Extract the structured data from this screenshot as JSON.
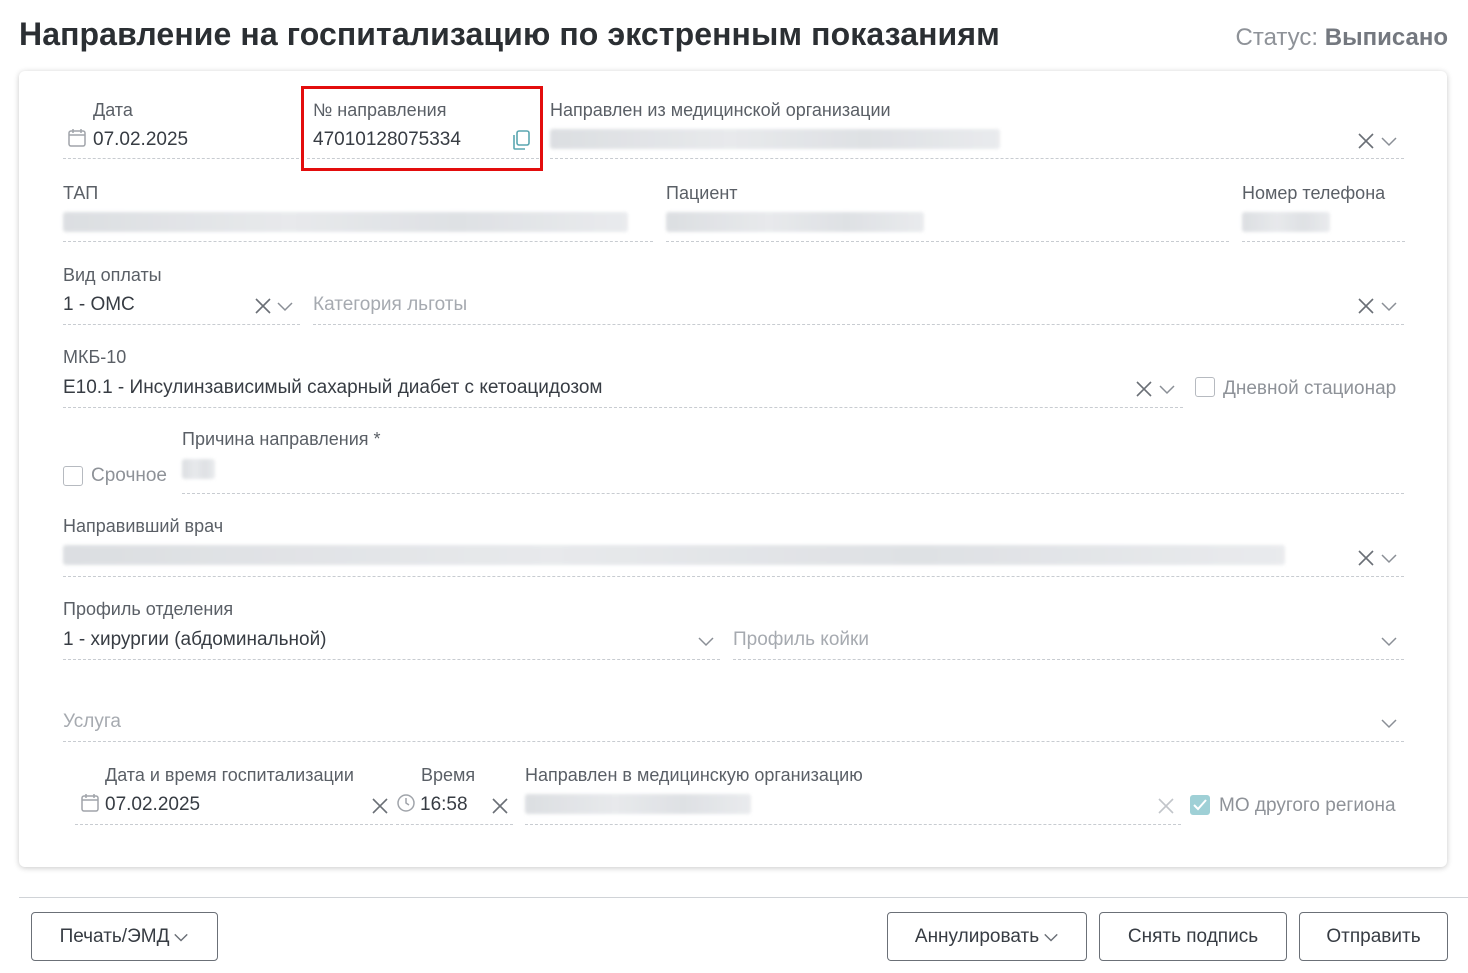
{
  "header": {
    "title": "Направление на госпитализацию по экстренным показаниям",
    "status_label": "Статус:",
    "status_value": "Выписано"
  },
  "form": {
    "date": {
      "label": "Дата",
      "value": "07.02.2025"
    },
    "referral_number": {
      "label": "№ направления",
      "value": "47010128075334"
    },
    "from_org": {
      "label": "Направлен из медицинской организации"
    },
    "tap": {
      "label": "ТАП"
    },
    "patient": {
      "label": "Пациент"
    },
    "phone": {
      "label": "Номер телефона"
    },
    "payment": {
      "label": "Вид оплаты",
      "value": "1 - ОМС"
    },
    "benefit": {
      "placeholder": "Категория льготы"
    },
    "mkb": {
      "label": "МКБ-10",
      "value": "E10.1 - Инсулинзависимый сахарный диабет с кетоацидозом"
    },
    "day_hospital": {
      "label": "Дневной стационар",
      "checked": false
    },
    "urgent": {
      "label": "Срочное",
      "checked": false
    },
    "reason": {
      "label": "Причина направления *"
    },
    "doctor": {
      "label": "Направивший врач"
    },
    "dept_profile": {
      "label": "Профиль отделения",
      "value": "1 - хирургии (абдоминальной)"
    },
    "bed_profile": {
      "placeholder": "Профиль койки"
    },
    "service": {
      "placeholder": "Услуга"
    },
    "hosp_datetime": {
      "label": "Дата и время госпитализации",
      "value": "07.02.2025"
    },
    "time": {
      "label": "Время",
      "value": "16:58"
    },
    "to_org": {
      "label": "Направлен в медицинскую организацию"
    },
    "other_region": {
      "label": "МО другого региона",
      "checked": true
    }
  },
  "footer": {
    "print_label": "Печать/ЭМД",
    "cancel_label": "Аннулировать",
    "unsign_label": "Снять подпись",
    "send_label": "Отправить"
  },
  "icons": [
    "calendar-icon",
    "copy-icon",
    "close-icon",
    "chevron-down-icon",
    "clock-icon"
  ],
  "colors": {
    "highlight": "#e30d0d",
    "checkbox_checked": "#9fd0d6"
  }
}
